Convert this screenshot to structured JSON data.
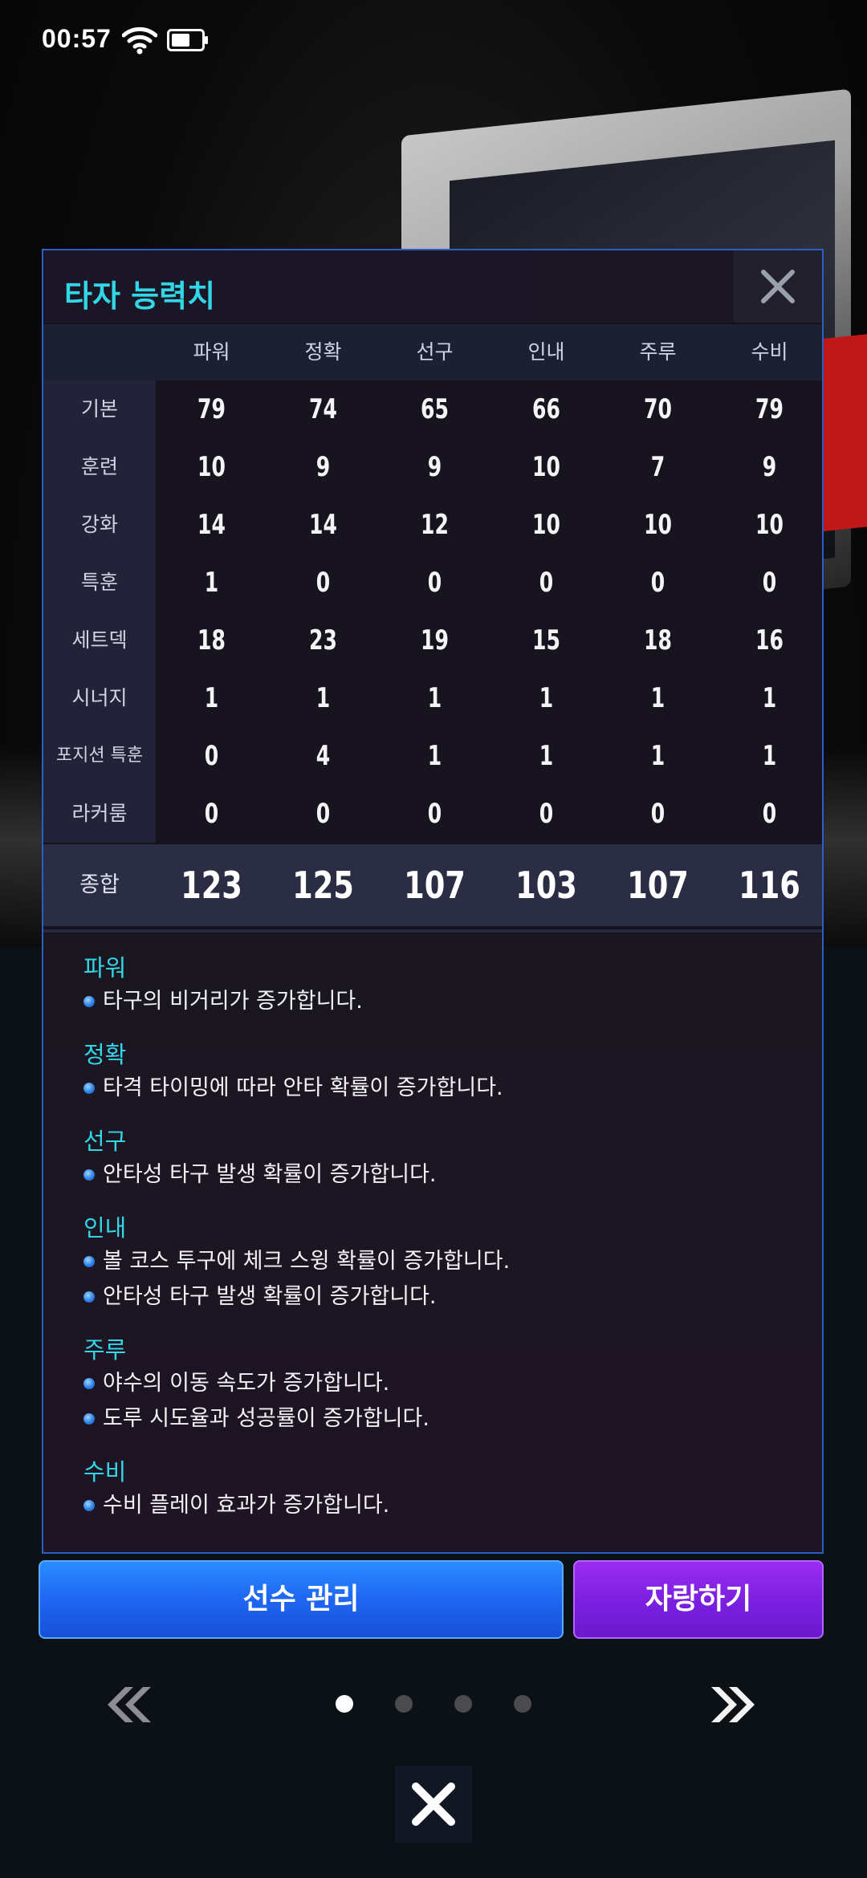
{
  "status_bar": {
    "time": "00:57"
  },
  "dialog": {
    "title": "타자 능력치",
    "columns": [
      "파워",
      "정확",
      "선구",
      "인내",
      "주루",
      "수비"
    ],
    "rows": [
      {
        "label": "기본",
        "values": [
          "79",
          "74",
          "65",
          "66",
          "70",
          "79"
        ]
      },
      {
        "label": "훈련",
        "values": [
          "10",
          "9",
          "9",
          "10",
          "7",
          "9"
        ]
      },
      {
        "label": "강화",
        "values": [
          "14",
          "14",
          "12",
          "10",
          "10",
          "10"
        ]
      },
      {
        "label": "특훈",
        "values": [
          "1",
          "0",
          "0",
          "0",
          "0",
          "0"
        ]
      },
      {
        "label": "세트덱",
        "values": [
          "18",
          "23",
          "19",
          "15",
          "18",
          "16"
        ]
      },
      {
        "label": "시너지",
        "values": [
          "1",
          "1",
          "1",
          "1",
          "1",
          "1"
        ]
      },
      {
        "label": "포지션 특훈",
        "values": [
          "0",
          "4",
          "1",
          "1",
          "1",
          "1"
        ]
      },
      {
        "label": "라커룸",
        "values": [
          "0",
          "0",
          "0",
          "0",
          "0",
          "0"
        ]
      }
    ],
    "total": {
      "label": "종합",
      "values": [
        "123",
        "125",
        "107",
        "103",
        "107",
        "116"
      ]
    },
    "descriptions": [
      {
        "title": "파워",
        "items": [
          "타구의 비거리가 증가합니다."
        ]
      },
      {
        "title": "정확",
        "items": [
          "타격 타이밍에 따라 안타 확률이 증가합니다."
        ]
      },
      {
        "title": "선구",
        "items": [
          "안타성 타구 발생 확률이 증가합니다."
        ]
      },
      {
        "title": "인내",
        "items": [
          "볼 코스 투구에 체크 스윙 확률이 증가합니다.",
          "안타성 타구 발생 확률이 증가합니다."
        ]
      },
      {
        "title": "주루",
        "items": [
          "야수의 이동 속도가 증가합니다.",
          "도루 시도율과 성공률이 증가합니다."
        ]
      },
      {
        "title": "수비",
        "items": [
          "수비 플레이 효과가 증가합니다."
        ]
      }
    ]
  },
  "buttons": {
    "manage": "선수 관리",
    "share": "자랑하기"
  },
  "pager": {
    "total": 4,
    "active": 1
  },
  "colors": {
    "accent_cyan": "#33d6e6",
    "manage_blue": "#1f66f2",
    "share_purple": "#7a1fe0",
    "dialog_border": "#2a5fc6"
  }
}
